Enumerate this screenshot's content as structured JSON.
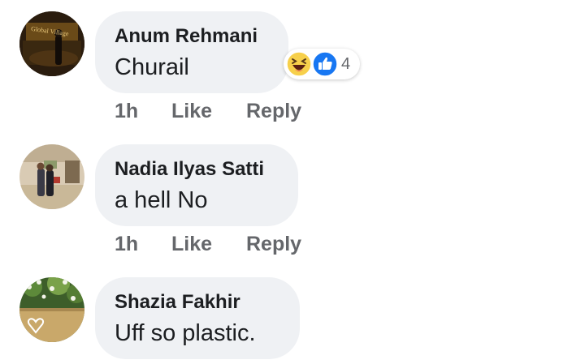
{
  "comments": [
    {
      "author": "Anum Rehmani",
      "text": "Churail",
      "time": "1h",
      "like_label": "Like",
      "reply_label": "Reply",
      "avatar_sign_text": "Global Village",
      "reactions": {
        "icons": [
          "haha-icon",
          "like-icon"
        ],
        "count": "4"
      }
    },
    {
      "author": "Nadia Ilyas Satti",
      "text": "a hell No",
      "time": "1h",
      "like_label": "Like",
      "reply_label": "Reply"
    },
    {
      "author": "Shazia Fakhir",
      "text": "Uff so plastic."
    }
  ],
  "colors": {
    "bubble_bg": "#eff1f4",
    "name_text": "#1c1e21",
    "action_text": "#65676b",
    "like_blue": "#1877f2",
    "haha_yellow": "#f7d04b"
  }
}
